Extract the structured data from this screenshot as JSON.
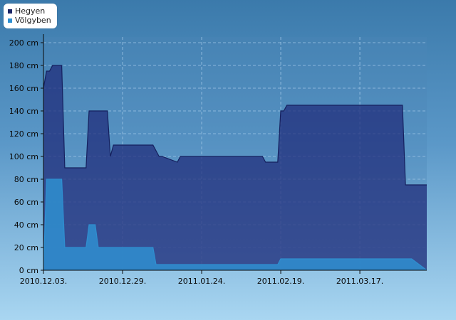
{
  "chart_data": {
    "type": "area",
    "title": "",
    "xlabel": "",
    "ylabel": "",
    "x_tick_labels": [
      "2010.12.03.",
      "2010.12.29.",
      "2011.01.24.",
      "2011.02.19.",
      "2011.03.17."
    ],
    "y_ticks": [
      0,
      20,
      40,
      60,
      80,
      100,
      120,
      140,
      160,
      180,
      200
    ],
    "y_unit": "cm",
    "ylim": [
      0,
      205
    ],
    "xlim": [
      "2010.12.03.",
      "2011.04.08."
    ],
    "grid": true,
    "legend_position": "top-left",
    "series": [
      {
        "name": "Hegyen",
        "color": "#1a2466",
        "x": [
          "2010.12.03.",
          "2010.12.04.",
          "2010.12.05.",
          "2010.12.06.",
          "2010.12.07.",
          "2010.12.09.",
          "2010.12.10.",
          "2010.12.17.",
          "2010.12.18.",
          "2010.12.24.",
          "2010.12.25.",
          "2010.12.26.",
          "2011.01.08.",
          "2011.01.10.",
          "2011.01.11.",
          "2011.01.16.",
          "2011.01.17.",
          "2011.02.13.",
          "2011.02.14.",
          "2011.02.18.",
          "2011.02.19.",
          "2011.02.20.",
          "2011.02.21.",
          "2011.03.31.",
          "2011.04.01.",
          "2011.04.08."
        ],
        "values": [
          160,
          175,
          175,
          180,
          180,
          180,
          90,
          90,
          140,
          140,
          100,
          110,
          110,
          100,
          100,
          95,
          100,
          100,
          95,
          95,
          140,
          140,
          145,
          145,
          75,
          75
        ]
      },
      {
        "name": "Völgyben",
        "color": "#2f8fd0",
        "x": [
          "2010.12.03.",
          "2010.12.04.",
          "2010.12.09.",
          "2010.12.10.",
          "2010.12.17.",
          "2010.12.18.",
          "2010.12.20.",
          "2010.12.21.",
          "2011.01.08.",
          "2011.01.09.",
          "2011.02.18.",
          "2011.02.19.",
          "2011.04.03.",
          "2011.04.08."
        ],
        "values": [
          0,
          80,
          80,
          20,
          20,
          40,
          40,
          20,
          20,
          5,
          5,
          10,
          10,
          0
        ]
      }
    ]
  }
}
